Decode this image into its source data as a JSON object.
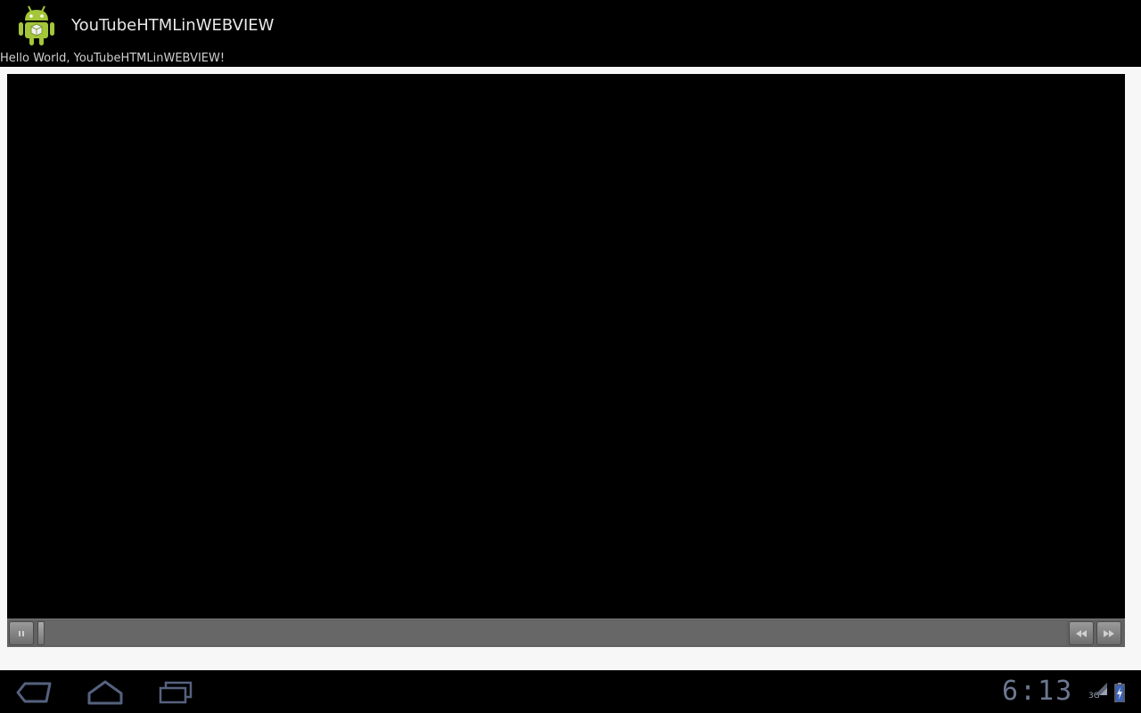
{
  "app": {
    "title": "YouTubeHTMLinWEBVIEW",
    "icon": "android-robot-icon"
  },
  "content": {
    "hello_text": "Hello World, YouTubeHTMLinWEBVIEW!"
  },
  "player": {
    "buttons": {
      "pause": "pause-icon",
      "rewind": "rewind-icon",
      "fast_forward": "fast-forward-icon"
    },
    "progress": 0
  },
  "system_bar": {
    "time": "6:13",
    "network": "3G",
    "nav": [
      "back-icon",
      "home-icon",
      "recent-apps-icon"
    ]
  },
  "colors": {
    "android_green": "#a4c639",
    "clock_color": "#6c7790"
  }
}
